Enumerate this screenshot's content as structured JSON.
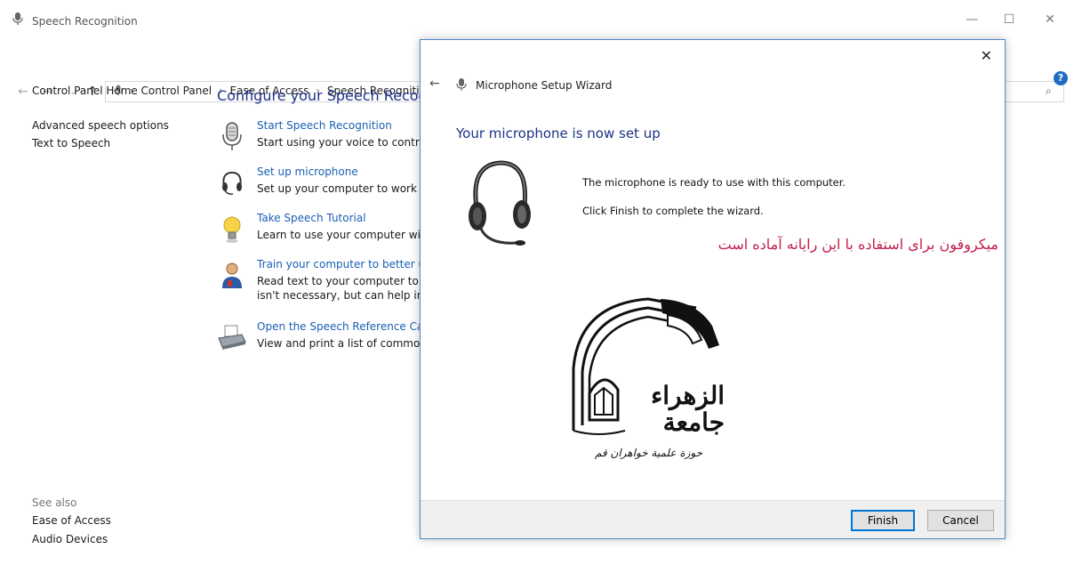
{
  "window": {
    "title": "Speech Recognition",
    "controls": {
      "minimize": "—",
      "maximize": "☐",
      "close": "✕"
    }
  },
  "addressbar": {
    "back": "←",
    "forward": "→",
    "recent": "⌄",
    "up": "↑",
    "crumbs": [
      "Control Panel",
      "Ease of Access",
      "Speech Recognitio"
    ],
    "separator": "›",
    "search_icon": "⌕"
  },
  "left_nav": {
    "items": [
      "Control Panel Home",
      "Advanced speech options",
      "Text to Speech"
    ]
  },
  "see_also": {
    "title": "See also",
    "items": [
      "Ease of Access",
      "Audio Devices"
    ]
  },
  "help": {
    "label": "?"
  },
  "main": {
    "heading": "Configure your Speech Recogn",
    "tasks": [
      {
        "icon": "microphone-icon",
        "link": "Start Speech Recognition",
        "desc": "Start using your voice to control"
      },
      {
        "icon": "headset-icon",
        "link": "Set up microphone",
        "desc": "Set up your computer to work pr"
      },
      {
        "icon": "lightbulb-icon",
        "link": "Take Speech Tutorial",
        "desc": "Learn to use your computer with"
      },
      {
        "icon": "user-icon",
        "link": "Train your computer to better ur",
        "desc": "Read text to your computer to in",
        "desc2": "isn't necessary, but can help imp"
      },
      {
        "icon": "printer-icon",
        "link": "Open the Speech Reference Card",
        "desc": "View and print a list of common"
      }
    ]
  },
  "wizard": {
    "close": "✕",
    "back": "←",
    "title": "Microphone Setup Wizard",
    "heading": "Your microphone is now set up",
    "message1": "The microphone is ready to use with this computer.",
    "message2": "Click Finish to complete the wizard.",
    "persian_note": "میکروفون برای استفاده با این رایانه آماده است",
    "logo_text": "الزهراء جامعة",
    "logo_subtext": "حوزة علمية خواهران قم",
    "buttons": {
      "finish": "Finish",
      "cancel": "Cancel"
    }
  },
  "colors": {
    "link": "#1a5fb4",
    "heading": "#1e3287",
    "persian": "#c0204a",
    "accent_border": "#0078d7"
  }
}
